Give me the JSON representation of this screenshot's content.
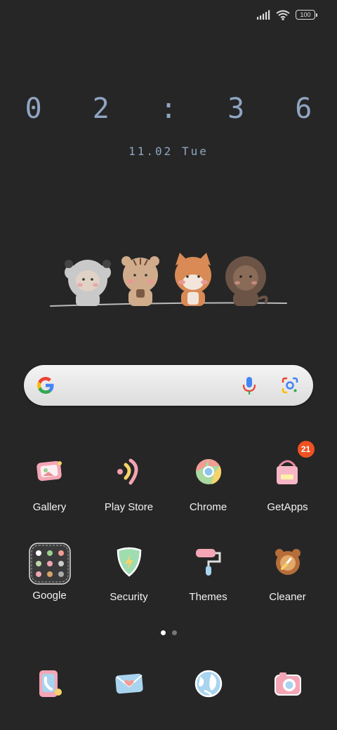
{
  "status": {
    "battery": "100",
    "icons": [
      "signal-icon",
      "wifi-icon",
      "battery-icon"
    ]
  },
  "clock": {
    "time": "0 2 : 3 6",
    "date": "11.02 Tue"
  },
  "search": {
    "icons": [
      "google-logo-icon",
      "microphone-icon",
      "google-lens-icon"
    ]
  },
  "apps": [
    {
      "label": "Gallery",
      "icon": "gallery-icon"
    },
    {
      "label": "Play Store",
      "icon": "play-store-icon"
    },
    {
      "label": "Chrome",
      "icon": "chrome-icon"
    },
    {
      "label": "GetApps",
      "icon": "getapps-icon",
      "badge": "21"
    },
    {
      "label": "Google",
      "icon": "google-folder-icon"
    },
    {
      "label": "Security",
      "icon": "security-icon"
    },
    {
      "label": "Themes",
      "icon": "themes-icon"
    },
    {
      "label": "Cleaner",
      "icon": "cleaner-icon"
    }
  ],
  "pager": {
    "pages": 2,
    "current": 1
  },
  "dock": [
    {
      "icon": "phone-icon"
    },
    {
      "icon": "messages-icon"
    },
    {
      "icon": "browser-icon"
    },
    {
      "icon": "camera-icon"
    }
  ],
  "colors": {
    "background": "#262626",
    "clock": "#8fa6c2",
    "badge": "#f05222"
  }
}
